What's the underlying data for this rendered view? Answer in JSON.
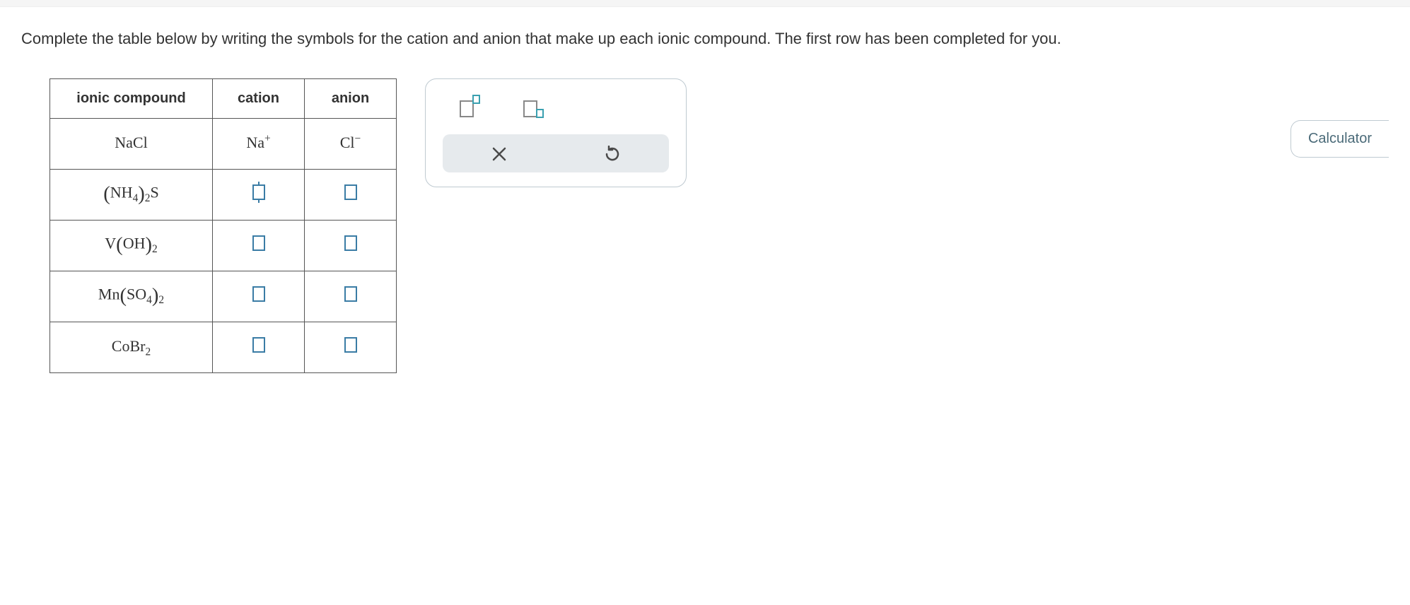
{
  "prompt": "Complete the table below by writing the symbols for the cation and anion that make up each ionic compound. The first row has been completed for you.",
  "table": {
    "headers": {
      "compound": "ionic compound",
      "cation": "cation",
      "anion": "anion"
    },
    "rows": [
      {
        "compound_html": "NaCl",
        "cation_html": "Na<sup>+</sup>",
        "anion_html": "Cl<sup>−</sup>",
        "prefilled": true
      },
      {
        "compound_html": "<span class='paren'>(</span>NH<sub>4</sub><span class='paren'>)</span><sub>2</sub>S",
        "prefilled": false,
        "focused": "cation"
      },
      {
        "compound_html": "V<span class='paren'>(</span>OH<span class='paren'>)</span><sub>2</sub>",
        "prefilled": false
      },
      {
        "compound_html": "Mn<span class='paren'>(</span>SO<sub>4</sub><span class='paren'>)</span><sub>2</sub>",
        "prefilled": false
      },
      {
        "compound_html": "CoBr<sub>2</sub>",
        "prefilled": false
      }
    ]
  },
  "toolbox": {
    "superscript_tool": "superscript",
    "subscript_tool": "subscript",
    "clear": "clear",
    "reset": "reset"
  },
  "calculator_label": "Calculator"
}
